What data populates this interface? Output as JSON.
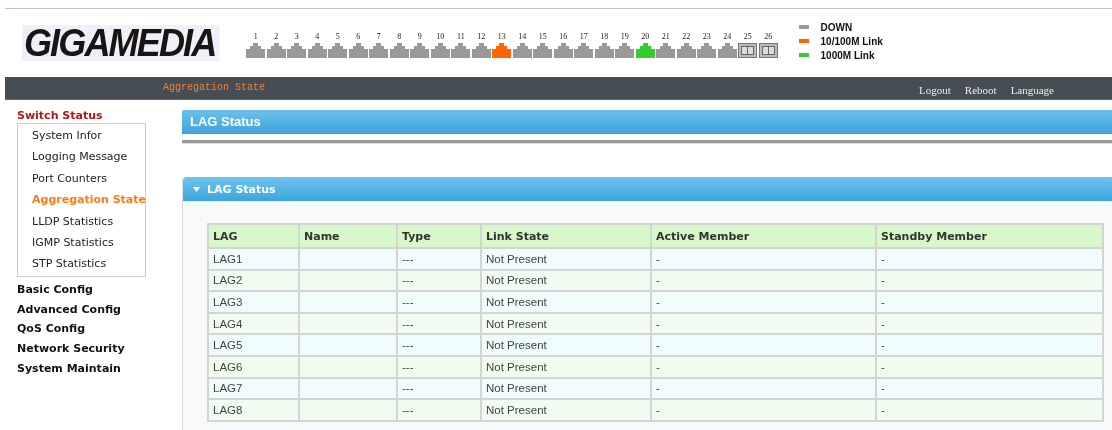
{
  "logo": {
    "text": "GIGAMEDIA"
  },
  "ports": [
    {
      "label": "1",
      "kind": "rj45",
      "color": "#999999"
    },
    {
      "label": "2",
      "kind": "rj45",
      "color": "#999999"
    },
    {
      "label": "3",
      "kind": "rj45",
      "color": "#999999"
    },
    {
      "label": "4",
      "kind": "rj45",
      "color": "#999999"
    },
    {
      "label": "5",
      "kind": "rj45",
      "color": "#999999"
    },
    {
      "label": "6",
      "kind": "rj45",
      "color": "#999999"
    },
    {
      "label": "7",
      "kind": "rj45",
      "color": "#999999"
    },
    {
      "label": "8",
      "kind": "rj45",
      "color": "#999999"
    },
    {
      "label": "9",
      "kind": "rj45",
      "color": "#999999"
    },
    {
      "label": "10",
      "kind": "rj45",
      "color": "#999999"
    },
    {
      "label": "11",
      "kind": "rj45",
      "color": "#999999"
    },
    {
      "label": "12",
      "kind": "rj45",
      "color": "#999999"
    },
    {
      "label": "13",
      "kind": "rj45",
      "color": "#ff6600"
    },
    {
      "label": "14",
      "kind": "rj45",
      "color": "#999999"
    },
    {
      "label": "15",
      "kind": "rj45",
      "color": "#999999"
    },
    {
      "label": "16",
      "kind": "rj45",
      "color": "#999999"
    },
    {
      "label": "17",
      "kind": "rj45",
      "color": "#999999"
    },
    {
      "label": "18",
      "kind": "rj45",
      "color": "#999999"
    },
    {
      "label": "19",
      "kind": "rj45",
      "color": "#999999"
    },
    {
      "label": "20",
      "kind": "rj45",
      "color": "#33cc33"
    },
    {
      "label": "21",
      "kind": "rj45",
      "color": "#999999"
    },
    {
      "label": "22",
      "kind": "rj45",
      "color": "#999999"
    },
    {
      "label": "23",
      "kind": "rj45",
      "color": "#999999"
    },
    {
      "label": "24",
      "kind": "rj45",
      "color": "#999999"
    },
    {
      "label": "25",
      "kind": "sfp"
    },
    {
      "label": "26",
      "kind": "sfp"
    }
  ],
  "legend": [
    {
      "label": "DOWN",
      "color": "#999999"
    },
    {
      "label": "10/100M Link",
      "color": "#ff6600"
    },
    {
      "label": "1000M Link",
      "color": "#33cc33"
    }
  ],
  "nav_bar": {
    "breadcrumb": "Aggregation State",
    "links": [
      "Logout",
      "Reboot",
      "Language"
    ]
  },
  "sidebar": [
    {
      "label": "Switch Status",
      "expanded": true,
      "children": [
        {
          "label": "System Infor",
          "selected": false
        },
        {
          "label": "Logging Message",
          "selected": false
        },
        {
          "label": "Port Counters",
          "selected": false
        },
        {
          "label": "Aggregation State",
          "selected": true
        },
        {
          "label": "LLDP Statistics",
          "selected": false
        },
        {
          "label": "IGMP Statistics",
          "selected": false
        },
        {
          "label": "STP Statistics",
          "selected": false
        }
      ]
    },
    {
      "label": "Basic Config",
      "expanded": false
    },
    {
      "label": "Advanced Config",
      "expanded": false
    },
    {
      "label": "QoS Config",
      "expanded": false
    },
    {
      "label": "Network Security",
      "expanded": false
    },
    {
      "label": "System Maintain",
      "expanded": false
    }
  ],
  "page_title": "LAG Status",
  "panel": {
    "title": "LAG Status",
    "expanded": true
  },
  "table": {
    "columns": [
      "LAG",
      "Name",
      "Type",
      "Link State",
      "Active Member",
      "Standby Member"
    ],
    "rows": [
      [
        "LAG1",
        "",
        "---",
        "Not Present",
        "-",
        "-"
      ],
      [
        "LAG2",
        "",
        "---",
        "Not Present",
        "-",
        "-"
      ],
      [
        "LAG3",
        "",
        "---",
        "Not Present",
        "-",
        "-"
      ],
      [
        "LAG4",
        "",
        "---",
        "Not Present",
        "-",
        "-"
      ],
      [
        "LAG5",
        "",
        "---",
        "Not Present",
        "-",
        "-"
      ],
      [
        "LAG6",
        "",
        "---",
        "Not Present",
        "-",
        "-"
      ],
      [
        "LAG7",
        "",
        "---",
        "Not Present",
        "-",
        "-"
      ],
      [
        "LAG8",
        "",
        "---",
        "Not Present",
        "-",
        "-"
      ]
    ]
  }
}
